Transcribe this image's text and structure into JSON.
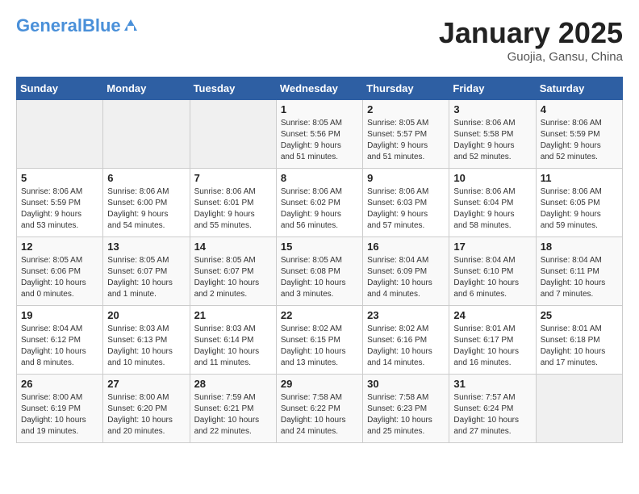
{
  "header": {
    "logo_line1": "General",
    "logo_line2": "Blue",
    "month": "January 2025",
    "location": "Guojia, Gansu, China"
  },
  "days_of_week": [
    "Sunday",
    "Monday",
    "Tuesday",
    "Wednesday",
    "Thursday",
    "Friday",
    "Saturday"
  ],
  "weeks": [
    [
      {
        "day": "",
        "info": ""
      },
      {
        "day": "",
        "info": ""
      },
      {
        "day": "",
        "info": ""
      },
      {
        "day": "1",
        "info": "Sunrise: 8:05 AM\nSunset: 5:56 PM\nDaylight: 9 hours\nand 51 minutes."
      },
      {
        "day": "2",
        "info": "Sunrise: 8:05 AM\nSunset: 5:57 PM\nDaylight: 9 hours\nand 51 minutes."
      },
      {
        "day": "3",
        "info": "Sunrise: 8:06 AM\nSunset: 5:58 PM\nDaylight: 9 hours\nand 52 minutes."
      },
      {
        "day": "4",
        "info": "Sunrise: 8:06 AM\nSunset: 5:59 PM\nDaylight: 9 hours\nand 52 minutes."
      }
    ],
    [
      {
        "day": "5",
        "info": "Sunrise: 8:06 AM\nSunset: 5:59 PM\nDaylight: 9 hours\nand 53 minutes."
      },
      {
        "day": "6",
        "info": "Sunrise: 8:06 AM\nSunset: 6:00 PM\nDaylight: 9 hours\nand 54 minutes."
      },
      {
        "day": "7",
        "info": "Sunrise: 8:06 AM\nSunset: 6:01 PM\nDaylight: 9 hours\nand 55 minutes."
      },
      {
        "day": "8",
        "info": "Sunrise: 8:06 AM\nSunset: 6:02 PM\nDaylight: 9 hours\nand 56 minutes."
      },
      {
        "day": "9",
        "info": "Sunrise: 8:06 AM\nSunset: 6:03 PM\nDaylight: 9 hours\nand 57 minutes."
      },
      {
        "day": "10",
        "info": "Sunrise: 8:06 AM\nSunset: 6:04 PM\nDaylight: 9 hours\nand 58 minutes."
      },
      {
        "day": "11",
        "info": "Sunrise: 8:06 AM\nSunset: 6:05 PM\nDaylight: 9 hours\nand 59 minutes."
      }
    ],
    [
      {
        "day": "12",
        "info": "Sunrise: 8:05 AM\nSunset: 6:06 PM\nDaylight: 10 hours\nand 0 minutes."
      },
      {
        "day": "13",
        "info": "Sunrise: 8:05 AM\nSunset: 6:07 PM\nDaylight: 10 hours\nand 1 minute."
      },
      {
        "day": "14",
        "info": "Sunrise: 8:05 AM\nSunset: 6:07 PM\nDaylight: 10 hours\nand 2 minutes."
      },
      {
        "day": "15",
        "info": "Sunrise: 8:05 AM\nSunset: 6:08 PM\nDaylight: 10 hours\nand 3 minutes."
      },
      {
        "day": "16",
        "info": "Sunrise: 8:04 AM\nSunset: 6:09 PM\nDaylight: 10 hours\nand 4 minutes."
      },
      {
        "day": "17",
        "info": "Sunrise: 8:04 AM\nSunset: 6:10 PM\nDaylight: 10 hours\nand 6 minutes."
      },
      {
        "day": "18",
        "info": "Sunrise: 8:04 AM\nSunset: 6:11 PM\nDaylight: 10 hours\nand 7 minutes."
      }
    ],
    [
      {
        "day": "19",
        "info": "Sunrise: 8:04 AM\nSunset: 6:12 PM\nDaylight: 10 hours\nand 8 minutes."
      },
      {
        "day": "20",
        "info": "Sunrise: 8:03 AM\nSunset: 6:13 PM\nDaylight: 10 hours\nand 10 minutes."
      },
      {
        "day": "21",
        "info": "Sunrise: 8:03 AM\nSunset: 6:14 PM\nDaylight: 10 hours\nand 11 minutes."
      },
      {
        "day": "22",
        "info": "Sunrise: 8:02 AM\nSunset: 6:15 PM\nDaylight: 10 hours\nand 13 minutes."
      },
      {
        "day": "23",
        "info": "Sunrise: 8:02 AM\nSunset: 6:16 PM\nDaylight: 10 hours\nand 14 minutes."
      },
      {
        "day": "24",
        "info": "Sunrise: 8:01 AM\nSunset: 6:17 PM\nDaylight: 10 hours\nand 16 minutes."
      },
      {
        "day": "25",
        "info": "Sunrise: 8:01 AM\nSunset: 6:18 PM\nDaylight: 10 hours\nand 17 minutes."
      }
    ],
    [
      {
        "day": "26",
        "info": "Sunrise: 8:00 AM\nSunset: 6:19 PM\nDaylight: 10 hours\nand 19 minutes."
      },
      {
        "day": "27",
        "info": "Sunrise: 8:00 AM\nSunset: 6:20 PM\nDaylight: 10 hours\nand 20 minutes."
      },
      {
        "day": "28",
        "info": "Sunrise: 7:59 AM\nSunset: 6:21 PM\nDaylight: 10 hours\nand 22 minutes."
      },
      {
        "day": "29",
        "info": "Sunrise: 7:58 AM\nSunset: 6:22 PM\nDaylight: 10 hours\nand 24 minutes."
      },
      {
        "day": "30",
        "info": "Sunrise: 7:58 AM\nSunset: 6:23 PM\nDaylight: 10 hours\nand 25 minutes."
      },
      {
        "day": "31",
        "info": "Sunrise: 7:57 AM\nSunset: 6:24 PM\nDaylight: 10 hours\nand 27 minutes."
      },
      {
        "day": "",
        "info": ""
      }
    ]
  ]
}
